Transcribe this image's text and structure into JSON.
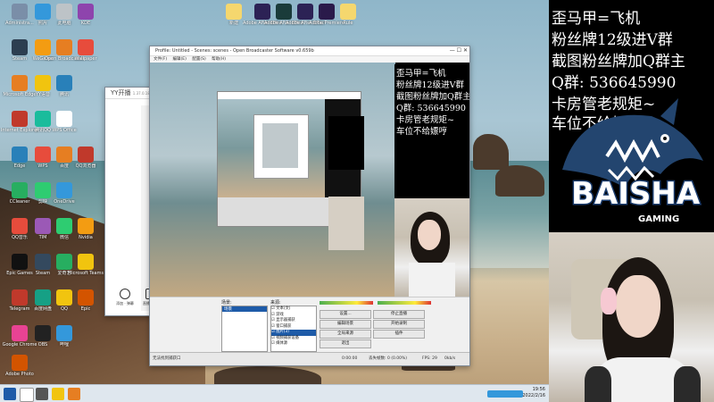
{
  "desktop": {
    "icons_col1": [
      "Administra...",
      "Steam",
      "Microsoft Edge",
      "Internet Explorer",
      "Edge",
      "CCleaner",
      "QQ音乐",
      "Epic Games",
      "Telegram",
      "Google Chrome",
      "Adobe Photo",
      "KDE",
      "Wallpaper",
      "Microsoft Teams"
    ],
    "icons_col2": [
      "照片",
      "WeGame",
      "YY语音",
      "腾讯QQ",
      "WPS",
      "剪映",
      "TIM",
      "Steam",
      "百度网盘",
      "OBS",
      "QQ浏览器",
      "Nvidia"
    ],
    "icons_col3": [
      "此电脑",
      "Open Broadcaster",
      "腾讯",
      "WPS Office",
      "百度",
      "OneDrive",
      "微信",
      "爱奇艺",
      "QQ",
      "哔哩",
      "Epic"
    ],
    "top_icons": [
      "新建",
      "Adobe After Effects",
      "Adobe After Effects",
      "Adobe After Effects",
      "Adobe Premiere",
      "Rule"
    ],
    "yy_window_title": "YY开播",
    "yy_version": "1.37.0.1860",
    "yy_btn1": "添加 · 弹幕",
    "yy_btn2": "直播设置"
  },
  "obs": {
    "title": "Profile: Untitled - Scenes: scenes - Open Broadcaster Software v0.659b",
    "menus": [
      "文件(F)",
      "编辑(E)",
      "配置(S)",
      "帮助(H)"
    ],
    "scenes_label": "场景:",
    "sources_label": "来源:",
    "scene_item": "场景",
    "sources": [
      "文本(文)",
      "游戏",
      "显示器捕获",
      "窗口捕获",
      "图片(3)",
      "视频捕获设备",
      "媒体源"
    ],
    "buttons": {
      "settings": "设置...",
      "start_stream": "停止直播",
      "edit_scene": "编辑场景",
      "start_preview": "开始录制",
      "global_sources": "全局来源",
      "plugins": "插件",
      "stop": "退出"
    },
    "status_left": "无法找到捕获口",
    "status_time": "0:00:00",
    "status_drop": "丢失帧数: 0 (0.00%)",
    "status_fps": "FPS: 29",
    "status_rate": "0kb/s"
  },
  "stream_overlay": {
    "line1": "歪马甲=飞机",
    "line2": "粉丝牌12级进V群",
    "line3": "截图粉丝牌加Q群主",
    "line4": "Q群: 536645990",
    "line5": "卡房管老规矩~",
    "line6": "车位不给嫖哼",
    "logo_text": "BAISHA",
    "logo_sub": "GAMING"
  },
  "taskbar": {
    "time": "19:56",
    "date": "2022/2/16"
  },
  "colors": {
    "accent_blue": "#1e5ba8",
    "logo_blue": "#1c3d6e",
    "obs_dark": "#2b2e38",
    "meter_red": "#d33"
  }
}
